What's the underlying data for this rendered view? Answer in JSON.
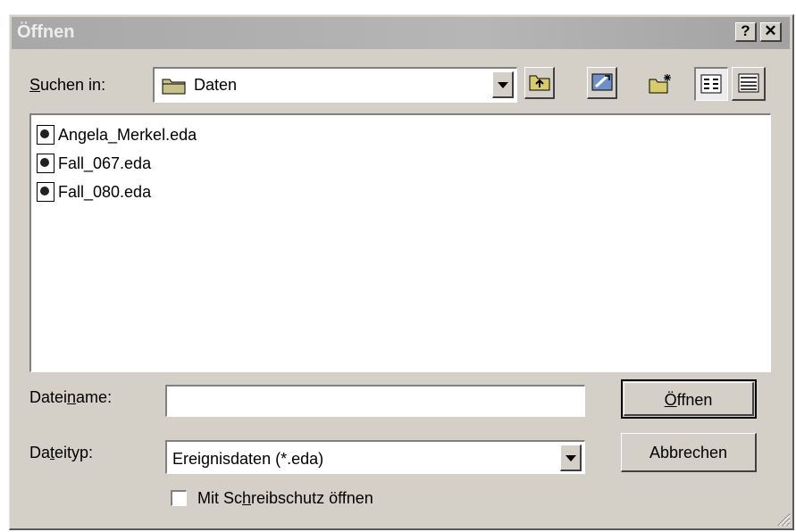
{
  "window": {
    "title": "Öffnen",
    "help_label": "?",
    "close_label": "✕"
  },
  "lookin": {
    "label_pre": "",
    "label_accel": "S",
    "label_post": "uchen in:",
    "value": "Daten"
  },
  "toolbar": {
    "buttons": [
      "up-one-level",
      "desktop",
      "create-new-folder",
      "list-view",
      "details-view"
    ]
  },
  "files": [
    {
      "name": "Angela_Merkel.eda"
    },
    {
      "name": "Fall_067.eda"
    },
    {
      "name": "Fall_080.eda"
    }
  ],
  "filename": {
    "label_pre": "Datei",
    "label_accel": "n",
    "label_post": "ame:",
    "value": ""
  },
  "filetype": {
    "label_pre": "Da",
    "label_accel": "t",
    "label_post": "eityp:",
    "value": "Ereignisdaten (*.eda)"
  },
  "buttons": {
    "open_pre": "",
    "open_accel": "Ö",
    "open_post": "ffnen",
    "cancel": "Abbrechen"
  },
  "readonly": {
    "label_pre": "Mit Sc",
    "label_accel": "h",
    "label_post": "reibschutz öffnen",
    "checked": false
  }
}
